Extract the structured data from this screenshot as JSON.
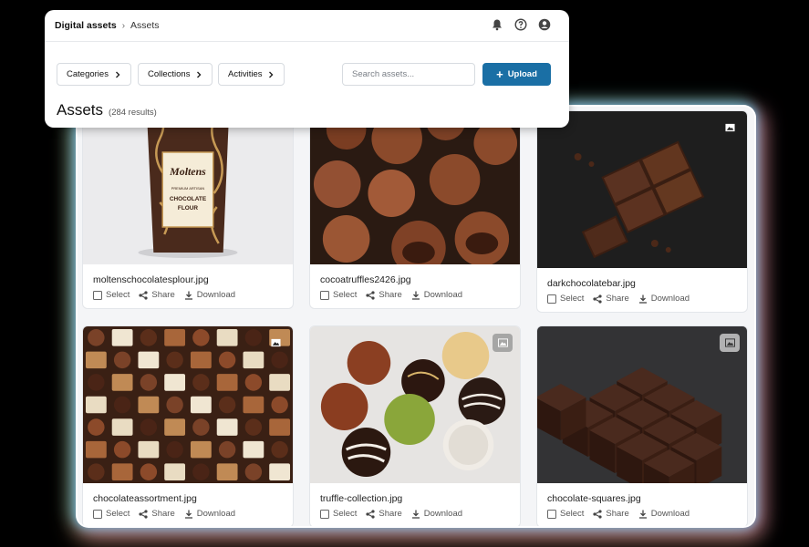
{
  "breadcrumb": {
    "root": "Digital assets",
    "current": "Assets"
  },
  "filters": [
    {
      "label": "Categories"
    },
    {
      "label": "Collections"
    },
    {
      "label": "Activities"
    }
  ],
  "search": {
    "placeholder": "Search assets..."
  },
  "upload_label": "Upload",
  "page": {
    "title": "Assets",
    "count": "(284 results)"
  },
  "action_labels": {
    "select": "Select",
    "share": "Share",
    "download": "Download"
  },
  "assets": [
    {
      "filename": "moltenschocolatesplour.jpg"
    },
    {
      "filename": "cocoatruffles2426.jpg"
    },
    {
      "filename": "darkchocolatebar.jpg"
    },
    {
      "filename": "chocolateassortment.jpg"
    },
    {
      "filename": "truffle-collection.jpg"
    },
    {
      "filename": "chocolate-squares.jpg"
    }
  ],
  "package_text": {
    "brand": "Moltens",
    "line1": "PREMIUM ARTISAN",
    "line2": "CHOCOLATE",
    "line3": "FLOUR"
  },
  "colors": {
    "accent": "#1a6fa5",
    "chocolate": "#5a3221",
    "cocoa": "#8b4a2b"
  }
}
